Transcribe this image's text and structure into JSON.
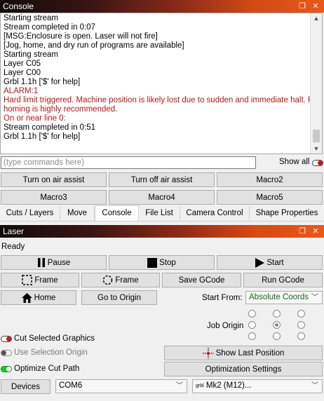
{
  "console_panel": {
    "title": "Console",
    "lines": [
      {
        "text": "Starting stream",
        "type": "normal"
      },
      {
        "text": "Stream completed in 0:07",
        "type": "normal"
      },
      {
        "text": "[MSG:Enclosure is open. Laser will not fire]",
        "type": "normal"
      },
      {
        "text": "[Jog, home, and dry run of programs are available]",
        "type": "normal"
      },
      {
        "text": "Starting stream",
        "type": "normal"
      },
      {
        "text": "Layer C05",
        "type": "normal"
      },
      {
        "text": "Layer C00",
        "type": "normal"
      },
      {
        "text": "Grbl 1.1h ['$' for help]",
        "type": "normal"
      },
      {
        "text": "ALARM:1",
        "type": "error"
      },
      {
        "text": "Hard limit triggered. Machine position is likely lost due to sudden and immediate halt. Re-",
        "type": "error"
      },
      {
        "text": "homing is highly recommended.",
        "type": "error"
      },
      {
        "text": "On or near line 0:",
        "type": "error"
      },
      {
        "text": "Stream completed in 0:51",
        "type": "normal"
      },
      {
        "text": "Grbl 1.1h ['$' for help]",
        "type": "normal"
      }
    ],
    "command_placeholder": "(type commands here)",
    "show_all_label": "Show all",
    "buttons": [
      "Turn on air assist",
      "Turn off air assist",
      "Macro2",
      "Macro3",
      "Macro4",
      "Macro5"
    ]
  },
  "tabs": [
    {
      "label": "Cuts / Layers",
      "active": false
    },
    {
      "label": "Move",
      "active": false
    },
    {
      "label": "Console",
      "active": true
    },
    {
      "label": "File List",
      "active": false
    },
    {
      "label": "Camera Control",
      "active": false
    },
    {
      "label": "Shape Properties",
      "active": false
    }
  ],
  "laser_panel": {
    "title": "Laser",
    "status": "Ready",
    "pause_label": "Pause",
    "stop_label": "Stop",
    "start_label": "Start",
    "frame1_label": "Frame",
    "frame2_label": "Frame",
    "save_gcode_label": "Save GCode",
    "run_gcode_label": "Run GCode",
    "home_label": "Home",
    "go_to_origin_label": "Go to Origin",
    "start_from_label": "Start From:",
    "start_from_value": "Absolute Coords",
    "job_origin_label": "Job Origin",
    "cut_selected_label": "Cut Selected Graphics",
    "use_selection_origin_label": "Use Selection Origin",
    "optimize_cut_path_label": "Optimize Cut Path",
    "show_last_position_label": "Show Last Position",
    "optimization_settings_label": "Optimization Settings",
    "devices_label": "Devices",
    "port_value": "COM6",
    "device_badge": "grbl",
    "device_value": "Mk2 (M12)..."
  },
  "colors": {
    "error_text": "#b01818",
    "toggle_on": "#22c422",
    "toggle_red": "#cc1818",
    "start_from_text": "#1a6a1a"
  }
}
